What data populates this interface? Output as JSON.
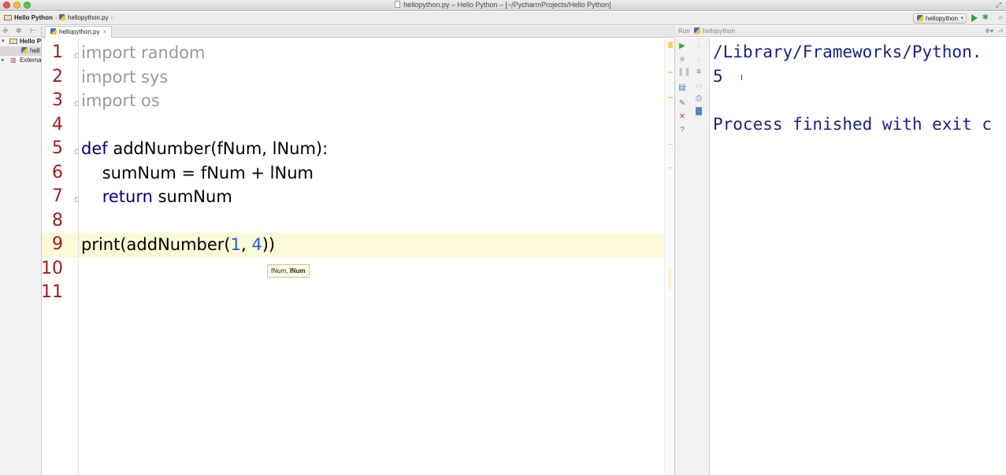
{
  "window": {
    "title": "hellopython.py – Hello Python – [~/PycharmProjects/Hello Python]"
  },
  "navbar": {
    "project_crumb": "Hello Python",
    "file_crumb": "hellopython.py",
    "run_config": "hellopython"
  },
  "project_tree": {
    "items": [
      {
        "label": "Hello P"
      },
      {
        "label": "hell"
      },
      {
        "label": "Externa"
      }
    ]
  },
  "editor": {
    "tab_label": "hellopython.py",
    "current_line": 9,
    "lines": [
      {
        "num": "1",
        "segments": [
          {
            "t": "import random",
            "c": "kw-dim"
          }
        ]
      },
      {
        "num": "2",
        "segments": [
          {
            "t": "import sys",
            "c": "kw-dim"
          }
        ]
      },
      {
        "num": "3",
        "segments": [
          {
            "t": "import os",
            "c": "kw-dim"
          }
        ]
      },
      {
        "num": "4",
        "segments": []
      },
      {
        "num": "5",
        "segments": [
          {
            "t": "def ",
            "c": "kw"
          },
          {
            "t": "addNumber(fNum, lNum):",
            "c": "plain"
          }
        ]
      },
      {
        "num": "6",
        "segments": [
          {
            "t": "    sumNum = fNum + lNum",
            "c": "plain"
          }
        ]
      },
      {
        "num": "7",
        "segments": [
          {
            "t": "    ",
            "c": "plain"
          },
          {
            "t": "return",
            "c": "kw"
          },
          {
            "t": " sumNum",
            "c": "plain"
          }
        ]
      },
      {
        "num": "8",
        "segments": []
      },
      {
        "num": "9",
        "segments": [
          {
            "t": "print(addNumber(",
            "c": "plain"
          },
          {
            "t": "1",
            "c": "num"
          },
          {
            "t": ", ",
            "c": "plain"
          },
          {
            "t": "4",
            "c": "num"
          },
          {
            "t": "))",
            "c": "plain"
          }
        ]
      },
      {
        "num": "10",
        "segments": []
      },
      {
        "num": "11",
        "segments": []
      }
    ],
    "tooltip_plain": "fNum, ",
    "tooltip_bold": "lNum"
  },
  "run_panel": {
    "label": "Run",
    "config_name": "hellopython",
    "console_lines": [
      "/Library/Frameworks/Python.",
      "5",
      "",
      "Process finished with exit c"
    ]
  },
  "colors": {
    "line_number": "#9a1c1c",
    "keyword": "#000080",
    "number": "#1f5fd6",
    "current_line_bg": "#fcf9d8",
    "console_text": "#1a237e"
  }
}
